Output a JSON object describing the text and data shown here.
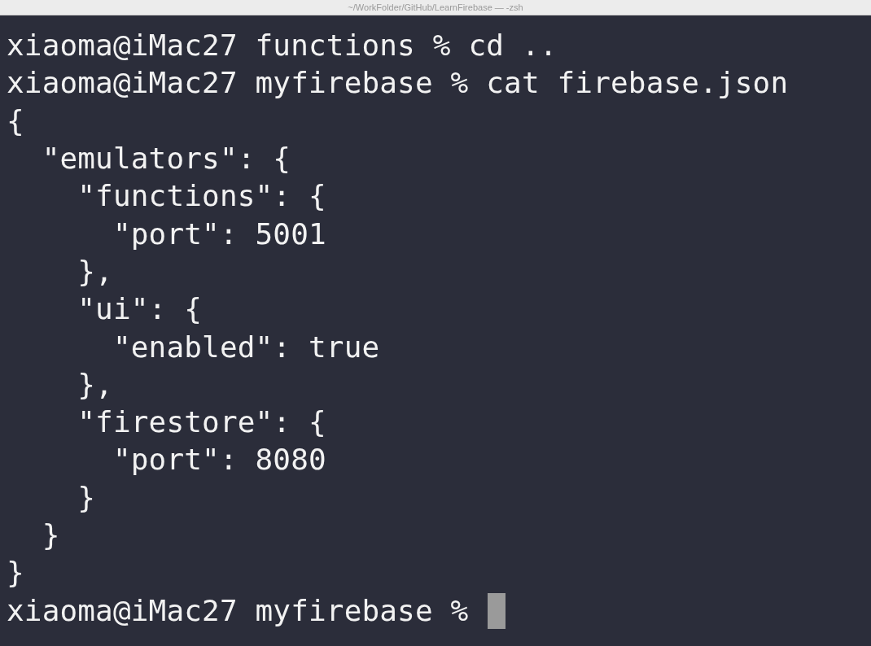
{
  "window": {
    "title": "~/WorkFolder/GitHub/LearnFirebase — -zsh"
  },
  "terminal": {
    "lines": [
      {
        "text": "xiaoma@iMac27 functions % cd .."
      },
      {
        "text": "xiaoma@iMac27 myfirebase % cat firebase.json"
      },
      {
        "text": "{"
      },
      {
        "text": "  \"emulators\": {"
      },
      {
        "text": "    \"functions\": {"
      },
      {
        "text": "      \"port\": 5001"
      },
      {
        "text": "    },"
      },
      {
        "text": "    \"ui\": {"
      },
      {
        "text": "      \"enabled\": true"
      },
      {
        "text": "    },"
      },
      {
        "text": "    \"firestore\": {"
      },
      {
        "text": "      \"port\": 8080"
      },
      {
        "text": "    }"
      },
      {
        "text": "  }"
      },
      {
        "text": "}"
      },
      {
        "text": "xiaoma@iMac27 myfirebase % ",
        "cursor": true
      }
    ]
  }
}
